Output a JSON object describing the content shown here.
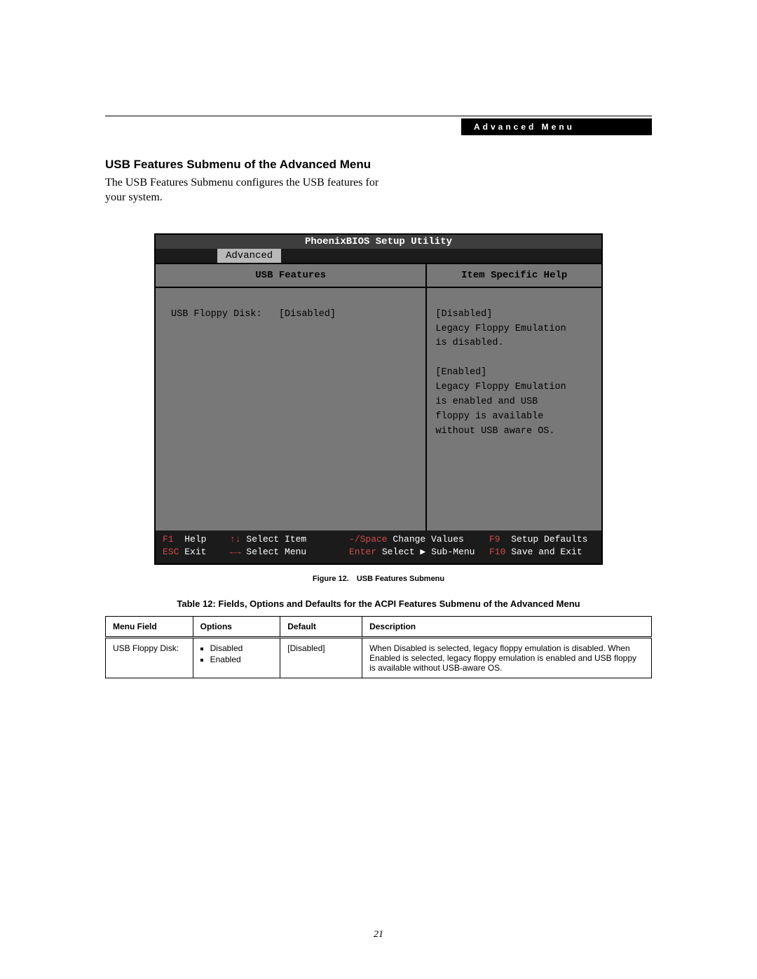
{
  "header": {
    "label": "Advanced Menu"
  },
  "section_title": "USB Features Submenu of the Advanced Menu",
  "intro": "The USB Features Submenu configures the USB features for your system.",
  "bios": {
    "title": "PhoenixBIOS Setup Utility",
    "tab": "Advanced",
    "left_title": "USB Features",
    "right_title": "Item Specific Help",
    "field_label": "USB Floppy Disk:",
    "field_value": "[Disabled]",
    "help_text": "[Disabled]\nLegacy Floppy Emulation\nis disabled.\n\n[Enabled]\nLegacy Floppy Emulation\nis enabled and USB\nfloppy is available\nwithout USB aware OS.",
    "footer": {
      "f1": "F1",
      "help": "Help",
      "arrows_ud": "↑↓",
      "select_item": "Select Item",
      "minus_space": "-/Space",
      "change_values": "Change Values",
      "f9": "F9",
      "setup_defaults": "Setup Defaults",
      "esc": "ESC",
      "exit": "Exit",
      "arrows_lr": "←→",
      "select_menu": "Select Menu",
      "enter": "Enter",
      "select_sub": "Select ▶ Sub-Menu",
      "f10": "F10",
      "save_exit": "Save and Exit"
    }
  },
  "figure_caption": "Figure 12. USB Features Submenu",
  "table_caption": "Table 12: Fields, Options and Defaults for the ACPI Features Submenu of the Advanced Menu",
  "table": {
    "headers": [
      "Menu Field",
      "Options",
      "Default",
      "Description"
    ],
    "row": {
      "menu_field": "USB Floppy Disk:",
      "option1": "Disabled",
      "option2": "Enabled",
      "default": "[Disabled]",
      "description": "When Disabled is selected, legacy floppy emulation is disabled. When Enabled is selected, legacy floppy emulation is enabled and USB floppy is available without USB-aware OS."
    }
  },
  "page_number": "21"
}
